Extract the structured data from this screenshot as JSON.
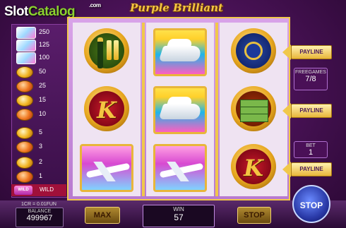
{
  "header": {
    "logo_slot": "Slot",
    "logo_catalog": "Catalog",
    "logo_dotcom": ".com",
    "game_title": "Purple Brilliant"
  },
  "paytable": {
    "rows": [
      {
        "symbol": "wild-card",
        "payout": "250"
      },
      {
        "symbol": "jet-card",
        "payout": "125"
      },
      {
        "symbol": "yacht-card",
        "payout": "100"
      },
      {
        "symbol": "coin",
        "payout": "50"
      },
      {
        "symbol": "coin",
        "payout": "25"
      },
      {
        "symbol": "coin",
        "payout": "15"
      },
      {
        "symbol": "coin",
        "payout": "10"
      },
      {
        "symbol": "coin",
        "payout": "5"
      },
      {
        "symbol": "coin",
        "payout": "3"
      },
      {
        "symbol": "coin",
        "payout": "2"
      },
      {
        "symbol": "coin",
        "payout": "1"
      }
    ],
    "wild_label": "WILD",
    "wild_icon_text": "WILD"
  },
  "reels": [
    [
      "champagne-icon",
      "k-icon",
      "jet-icon"
    ],
    [
      "yacht-icon",
      "yacht-icon",
      "jet-icon"
    ],
    [
      "watch-icon",
      "money-icon",
      "k-icon"
    ]
  ],
  "k_letter": "K",
  "paylines": [
    "PAYLINE",
    "PAYLINE",
    "PAYLINE"
  ],
  "freegames": {
    "label": "FREEGAMES",
    "value": "7/8"
  },
  "bet": {
    "label": "BET",
    "value": "1"
  },
  "bottom": {
    "rate": "1CR = 0.01FUN",
    "balance_label": "BALANCE",
    "balance_value": "499967",
    "max_label": "MAX",
    "win_label": "WIN",
    "win_value": "57",
    "stop_label": "STOP",
    "stop_main_label": "STOP"
  },
  "colors": {
    "gold": "#f0c84a",
    "purple": "#4a1257",
    "accent_green": "#8bd12f"
  }
}
